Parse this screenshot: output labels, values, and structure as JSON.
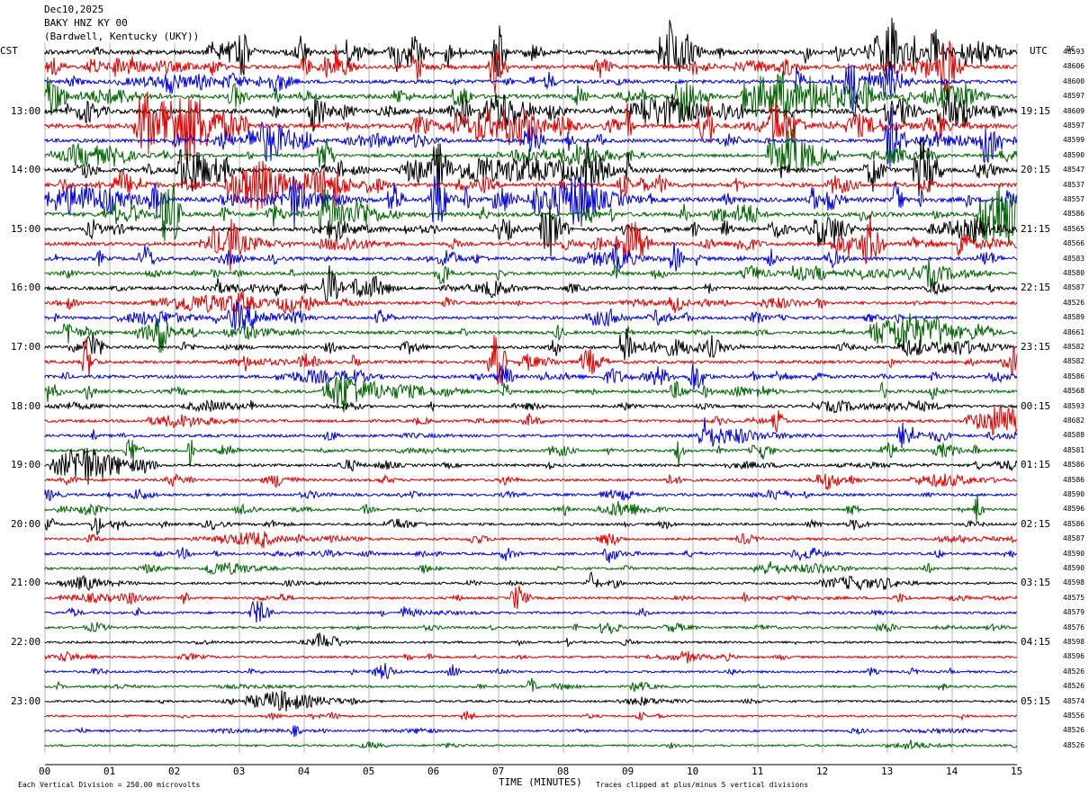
{
  "header": {
    "date": "Dec10,2025",
    "station": "BAKY HNZ KY 00",
    "location": "(Bardwell, Kentucky (UKY))"
  },
  "left_tz": "CST",
  "right_tz": "UTC",
  "dc_label": "DC",
  "footer": {
    "division": "Each Vertical Division =  250.00 microvolts",
    "xlabel": "TIME (MINUTES)",
    "clip_note": "Traces clipped at plus/minus 5 vertical divisions"
  },
  "colors": {
    "black": "#000000",
    "red": "#e00000",
    "blue": "#0000e0",
    "green": "#006400",
    "grid": "#808080"
  },
  "chart_data": {
    "type": "line",
    "title": "",
    "xlabel": "TIME (MINUTES)",
    "xlim": [
      0,
      15
    ],
    "x_ticks": [
      "00",
      "01",
      "02",
      "03",
      "04",
      "05",
      "06",
      "07",
      "08",
      "09",
      "10",
      "11",
      "12",
      "13",
      "14",
      "15"
    ],
    "trace_minutes": 15,
    "trace_count": 48,
    "color_cycle": [
      "black",
      "red",
      "blue",
      "green"
    ],
    "left_time_labels": [
      "13:00",
      "14:00",
      "15:00",
      "16:00",
      "17:00",
      "18:00",
      "19:00",
      "20:00",
      "21:00",
      "22:00",
      "23:00"
    ],
    "right_time_labels": [
      "19:15",
      "20:15",
      "21:15",
      "22:15",
      "23:15",
      "00:15",
      "01:15",
      "02:15",
      "03:15",
      "04:15",
      "05:15"
    ],
    "dc_offsets": [
      "48593",
      "48606",
      "48600",
      "48597",
      "48609",
      "48597",
      "48599",
      "48590",
      "48547",
      "48537",
      "48557",
      "48586",
      "48565",
      "48566",
      "48583",
      "48580",
      "48587",
      "48526",
      "48589",
      "48661",
      "48582",
      "48582",
      "48586",
      "48568",
      "48593",
      "48682",
      "48588",
      "48581",
      "48586",
      "48586",
      "48590",
      "48596",
      "48586",
      "48587",
      "48590",
      "48590",
      "48598",
      "48575",
      "48579",
      "48576",
      "48598",
      "48596",
      "48526",
      "48526",
      "48574",
      "48556",
      "48526",
      "48526"
    ],
    "activity": [
      3.5,
      2.5,
      2.5,
      3,
      3.5,
      3.5,
      2.5,
      2,
      3,
      3,
      3.5,
      3,
      2.5,
      2.5,
      2.5,
      2,
      2,
      2,
      2,
      2,
      2,
      2,
      2,
      2,
      1.6,
      1.6,
      1.6,
      1.6,
      1.5,
      1.5,
      1.4,
      1.4,
      1.3,
      1.3,
      1.3,
      1.3,
      1.2,
      1.2,
      1.2,
      1.2,
      1,
      1,
      1,
      1,
      0.9,
      0.8,
      0.8,
      0.8
    ]
  }
}
